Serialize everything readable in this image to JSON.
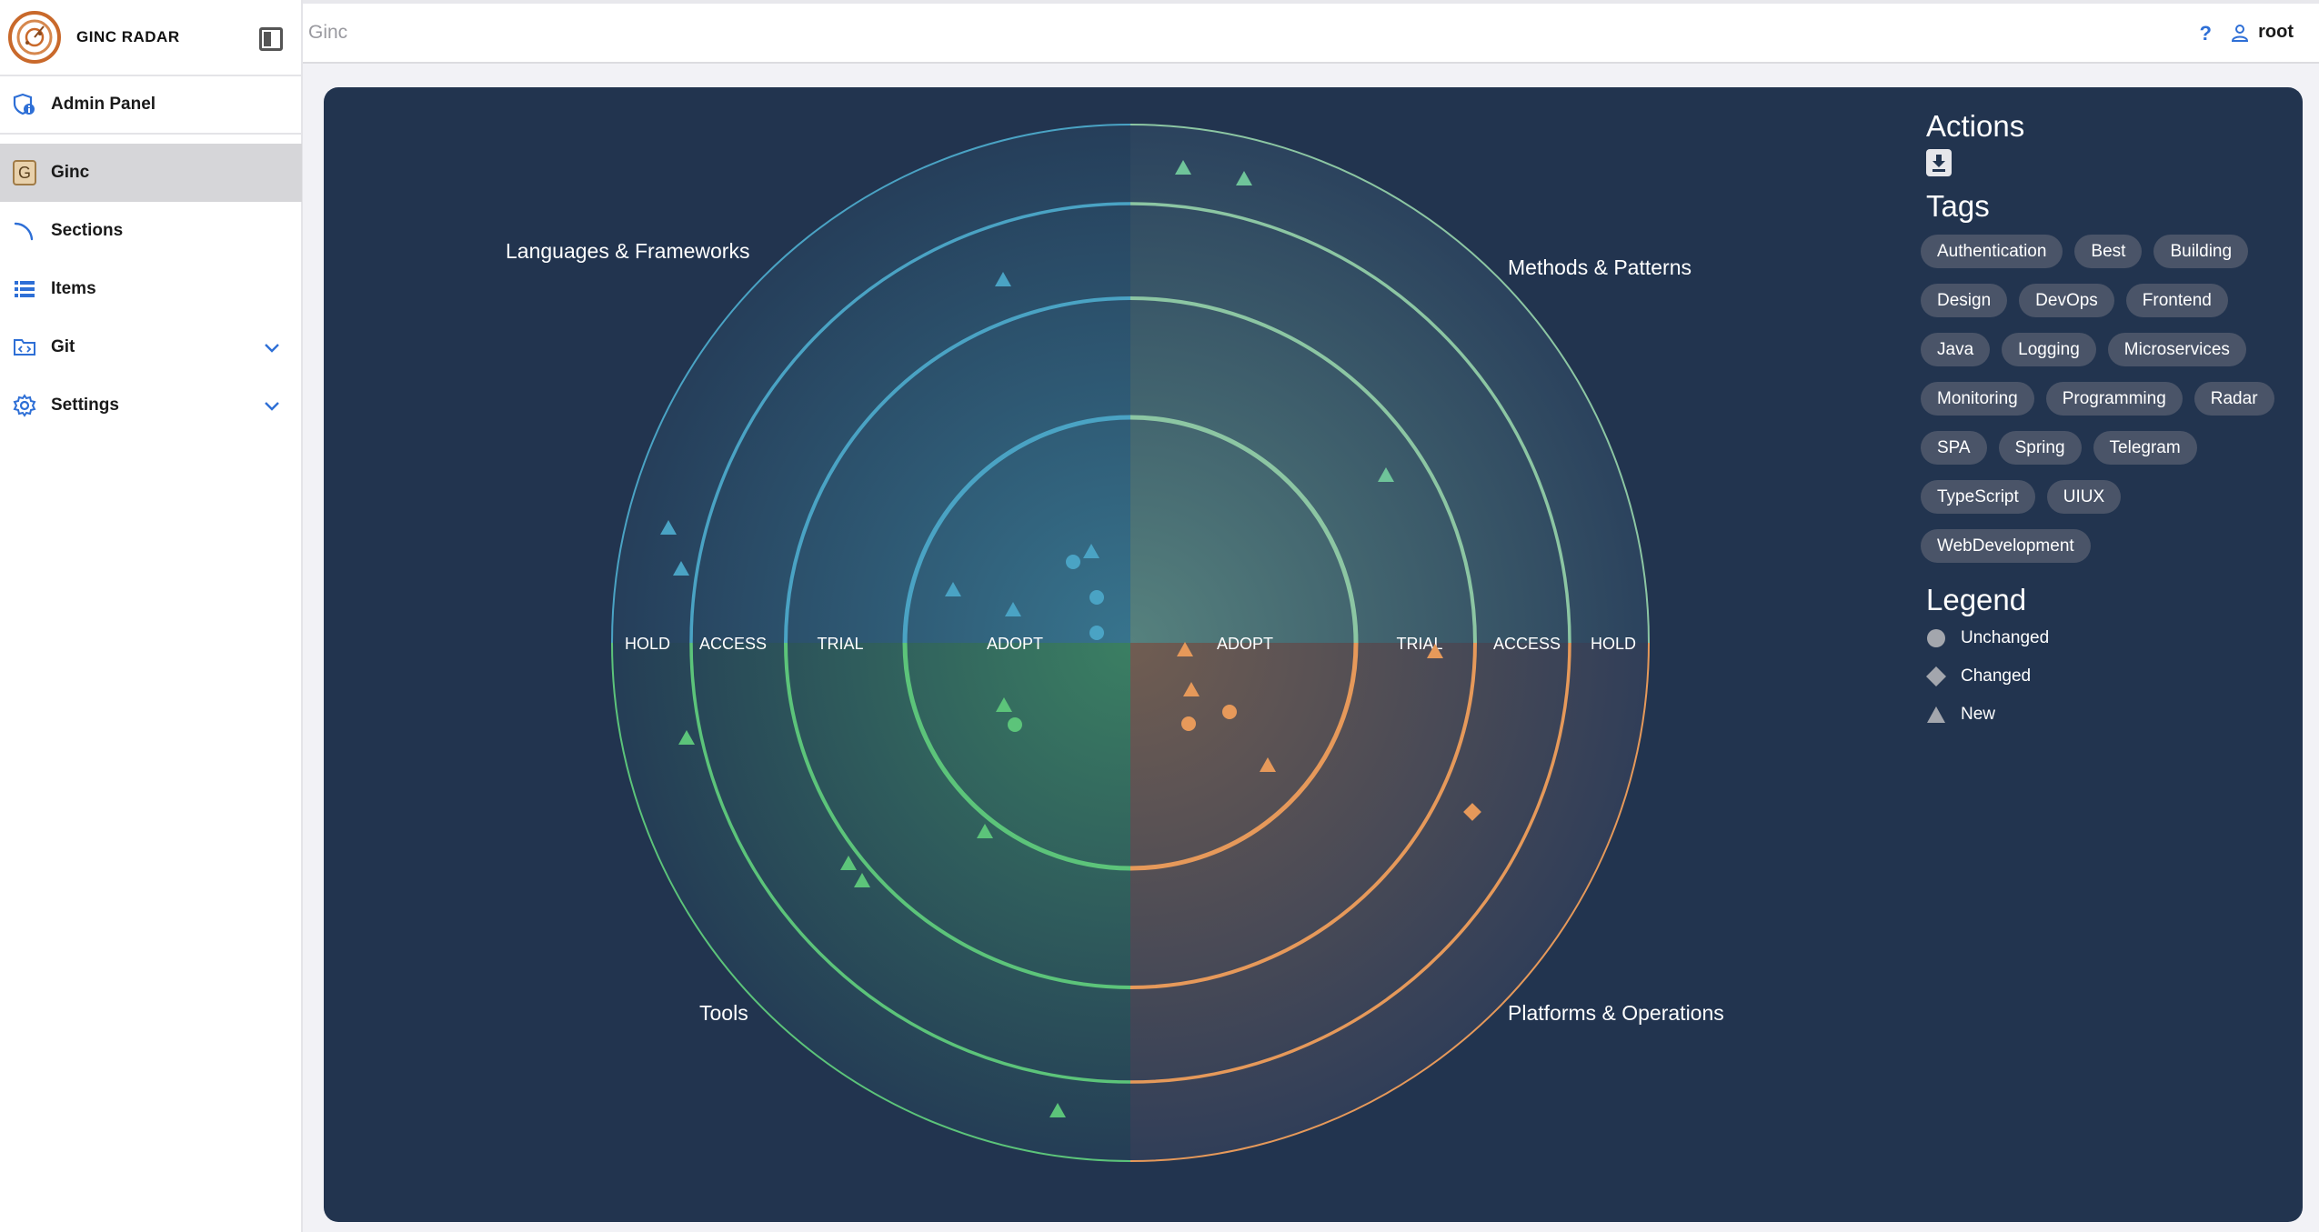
{
  "brand": {
    "name": "GINC RADAR"
  },
  "sidebar": {
    "items": [
      {
        "label": "Admin Panel"
      },
      {
        "label": "Ginc",
        "badge": "G"
      },
      {
        "label": "Sections"
      },
      {
        "label": "Items"
      },
      {
        "label": "Git"
      },
      {
        "label": "Settings"
      }
    ]
  },
  "topbar": {
    "breadcrumb": "Ginc",
    "help": "?",
    "user": "root"
  },
  "radar": {
    "quadrants": [
      "Languages & Frameworks",
      "Methods & Patterns",
      "Tools",
      "Platforms & Operations"
    ],
    "rings_left": [
      "HOLD",
      "ACCESS",
      "TRIAL",
      "ADOPT"
    ],
    "rings_right": [
      "ADOPT",
      "TRIAL",
      "ACCESS",
      "HOLD"
    ],
    "colors": {
      "languages": "#4aa3c4",
      "methods": "#8cc6a3",
      "tools": "#5cc47a",
      "platforms": "#e6995a"
    }
  },
  "actions": {
    "title": "Actions",
    "download_icon": "download-icon"
  },
  "tags": {
    "title": "Tags",
    "items": [
      "Authentication",
      "Best",
      "Building",
      "Design",
      "DevOps",
      "Frontend",
      "Java",
      "Logging",
      "Microservices",
      "Monitoring",
      "Programming",
      "Radar",
      "SPA",
      "Spring",
      "Telegram",
      "TypeScript",
      "UIUX",
      "WebDevelopment"
    ]
  },
  "legend": {
    "title": "Legend",
    "items": [
      {
        "label": "Unchanged",
        "shape": "circle"
      },
      {
        "label": "Changed",
        "shape": "diamond"
      },
      {
        "label": "New",
        "shape": "triangle"
      }
    ]
  }
}
